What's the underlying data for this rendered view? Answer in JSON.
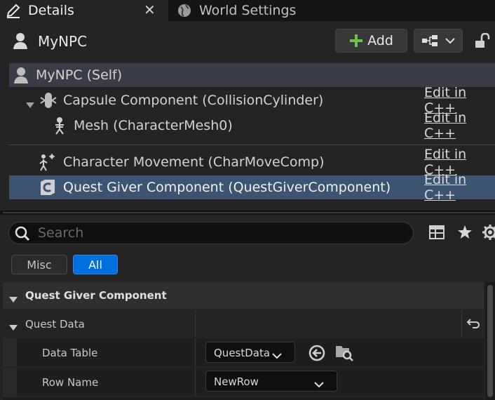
{
  "tabs": {
    "details": "Details",
    "world_settings": "World Settings",
    "close_glyph": "✕"
  },
  "header": {
    "actor_name": "MyNPC",
    "add_label": "Add"
  },
  "components": {
    "self": "MyNPC (Self)",
    "edit_label": "Edit in C++",
    "items": [
      {
        "label": "Capsule Component (CollisionCylinder)"
      },
      {
        "label": "Mesh (CharacterMesh0)"
      },
      {
        "label": "Character Movement (CharMoveComp)"
      },
      {
        "label": "Quest Giver Component (QuestGiverComponent)"
      }
    ]
  },
  "search": {
    "placeholder": "Search"
  },
  "filters": {
    "misc": "Misc",
    "all": "All"
  },
  "details": {
    "category": "Quest Giver Component",
    "quest_data": "Quest Data",
    "data_table_label": "Data Table",
    "data_table_value": "QuestData",
    "row_name_label": "Row Name",
    "row_name_value": "NewRow"
  },
  "colors": {
    "accent": "#0070e0",
    "selection": "#3d5470",
    "add_green": "#6cc24a",
    "panel": "#242424"
  }
}
